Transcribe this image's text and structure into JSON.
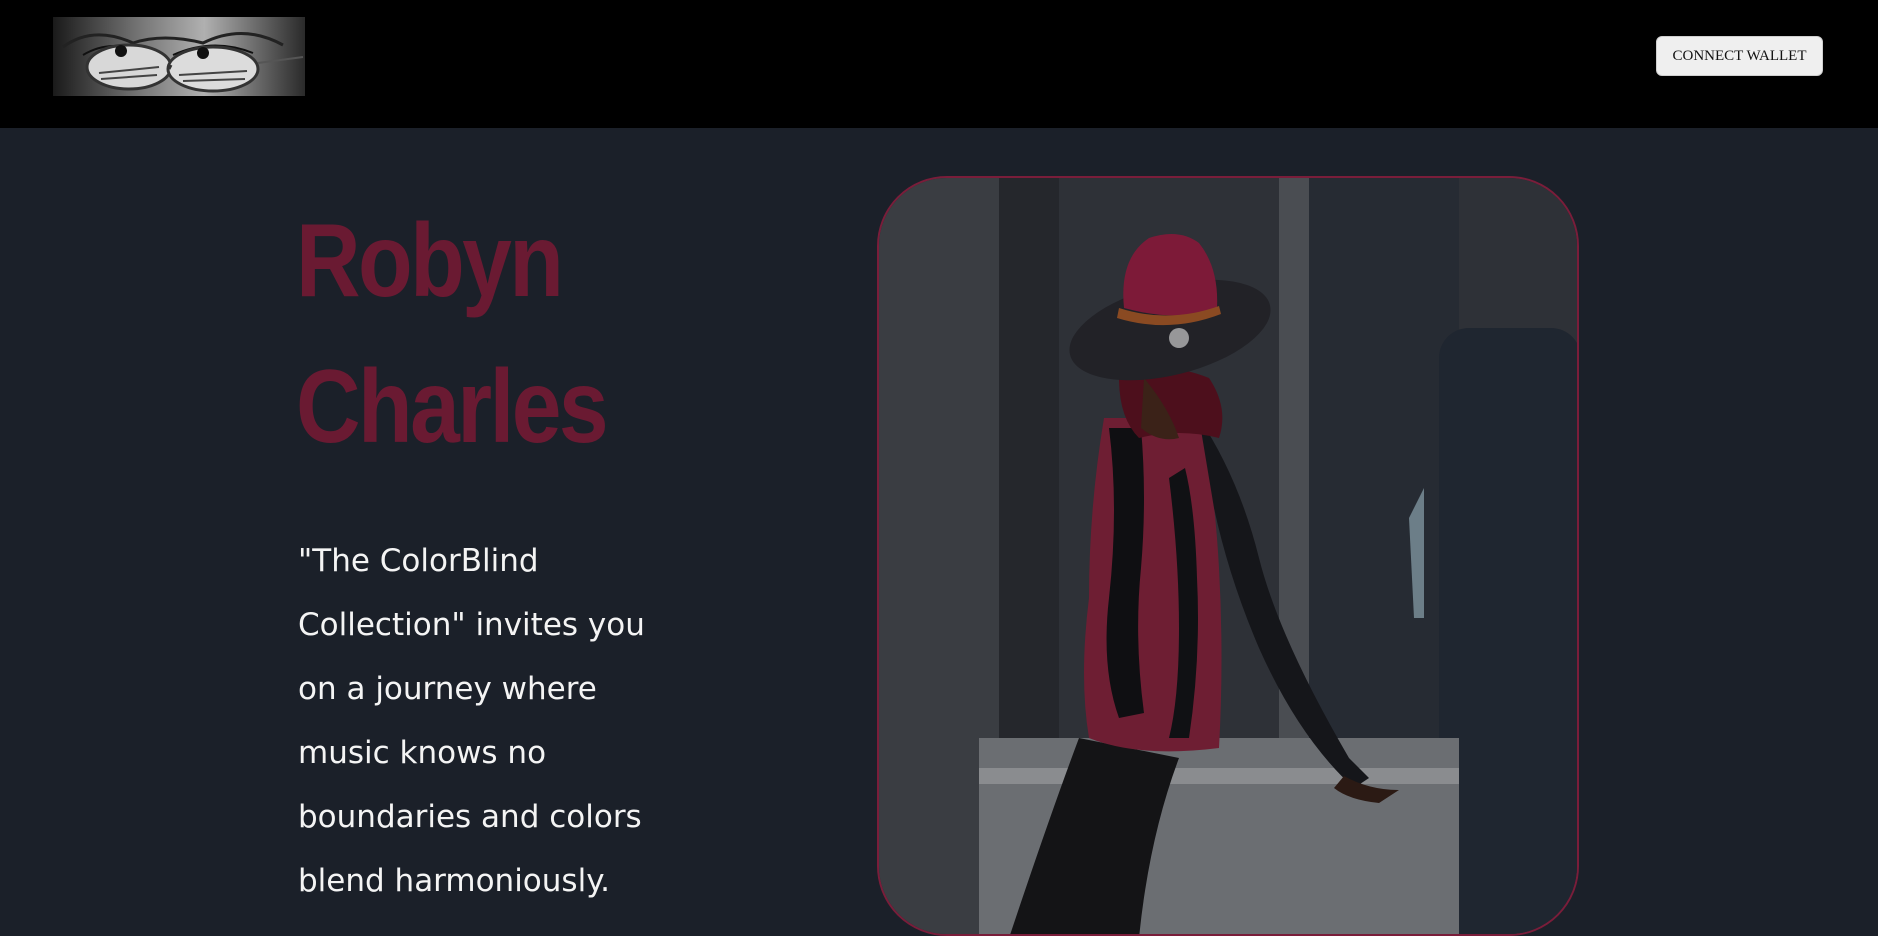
{
  "header": {
    "logo_alt": "",
    "connect_wallet_label": "CONNECT WALLET"
  },
  "hero": {
    "artist_name_line1": "Robyn",
    "artist_name_line2": "Charles",
    "tagline": "\"The ColorBlind Collection\" invites you on a journey where music knows no boundaries and colors blend harmoniously."
  },
  "colors": {
    "header_bg": "#000000",
    "page_bg": "#1b2029",
    "accent": "#6a1a32",
    "text": "#f4f4f4"
  },
  "icons": {
    "logo": "eyes-with-glasses-logo",
    "photo": "artist-portrait-image"
  }
}
